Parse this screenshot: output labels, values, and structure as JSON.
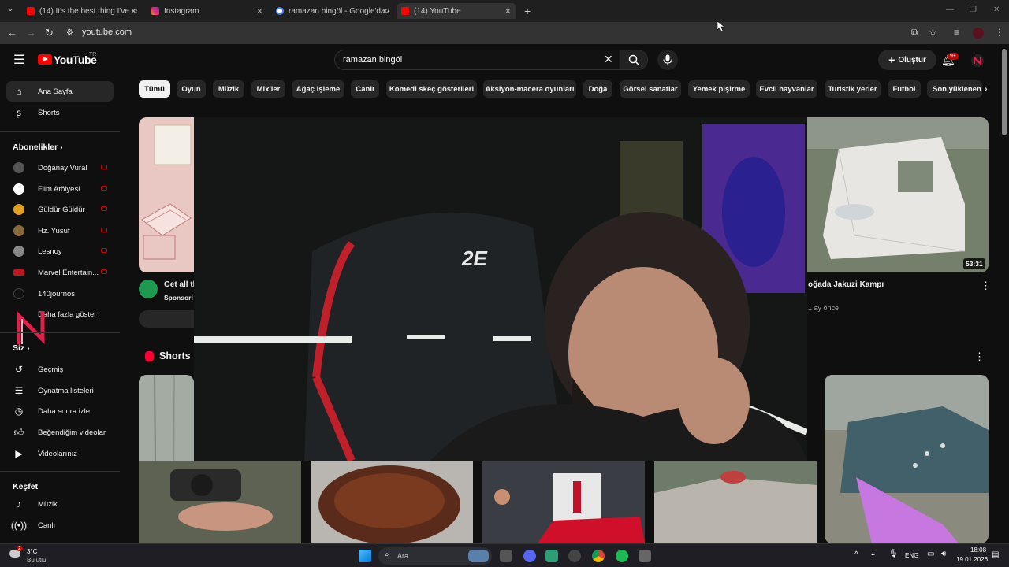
{
  "browser": {
    "tabs": [
      {
        "title": "(14) It's the best thing I've seen",
        "favicon_color": "#ff0000"
      },
      {
        "title": "Instagram",
        "favicon_color": "#e1306c"
      },
      {
        "title": "ramazan bingöl - Google'da Ar",
        "favicon_color": "#4285f4"
      },
      {
        "title": "(14) YouTube",
        "favicon_color": "#ff0000"
      }
    ],
    "url": "youtube.com"
  },
  "header": {
    "logo": "YouTube",
    "country": "TR",
    "search_query": "ramazan bingöl",
    "create_label": "Oluştur",
    "notif_count": "9+"
  },
  "sidebar": {
    "top_items": [
      {
        "label": "Ana Sayfa",
        "icon": "home-icon"
      },
      {
        "label": "Shorts",
        "icon": "shorts-icon"
      }
    ],
    "subs_heading": "Abonelikler",
    "subscriptions": [
      {
        "label": "Doğanay Vural",
        "avatar_color": "#555555",
        "live": true
      },
      {
        "label": "Film Atölyesi",
        "avatar_color": "#ffffff",
        "live": true
      },
      {
        "label": "Güldür Güldür",
        "avatar_color": "#e0a020",
        "live": true
      },
      {
        "label": "Hz. Yusuf",
        "avatar_color": "#8a6a3a",
        "live": true
      },
      {
        "label": "Lesnoy",
        "avatar_color": "#888888",
        "live": true
      },
      {
        "label": "Marvel Entertain...",
        "avatar_color": "#c0181e",
        "live": true
      },
      {
        "label": "140journos",
        "avatar_color": "#111111",
        "live": false
      }
    ],
    "more_label": "Daha fazla göster",
    "you_heading": "Siz",
    "you_items": [
      {
        "label": "Geçmiş",
        "icon": "history-icon"
      },
      {
        "label": "Oynatma listeleri",
        "icon": "playlist-icon"
      },
      {
        "label": "Daha sonra izle",
        "icon": "watch-later-icon"
      },
      {
        "label": "Beğendiğim videolar",
        "icon": "like-icon"
      },
      {
        "label": "Videolarınız",
        "icon": "your-videos-icon"
      }
    ],
    "explore_heading": "Keşfet",
    "explore_items": [
      {
        "label": "Müzik",
        "icon": "music-icon"
      },
      {
        "label": "Canlı",
        "icon": "live-icon"
      }
    ]
  },
  "chips": [
    "Tümü",
    "Oyun",
    "Müzik",
    "Mix'ler",
    "Ağaç işleme",
    "Canlı",
    "Komedi skeç gösterileri",
    "Aksiyon-macera oyunları",
    "Doğa",
    "Görsel sanatlar",
    "Yemek pişirme",
    "Evcil hayvanlar",
    "Turistik yerler",
    "Futbol",
    "Son yüklenen"
  ],
  "feed": {
    "ad_title": "Get all th",
    "ad_sponsor": "Sponsorl",
    "video2_title": "oğada Jakuzi Kampı",
    "video2_meta": "1 ay önce",
    "video2_duration": "53:31",
    "shorts_heading": "Shorts"
  },
  "overlay": {
    "chair_brand": "2E"
  },
  "taskbar": {
    "weather_temp": "3°C",
    "weather_desc": "Bulutlu",
    "weather_badge": "2",
    "search_placeholder": "Ara",
    "lang": "ENG",
    "time": "18:08",
    "date": "19.01.2026"
  }
}
